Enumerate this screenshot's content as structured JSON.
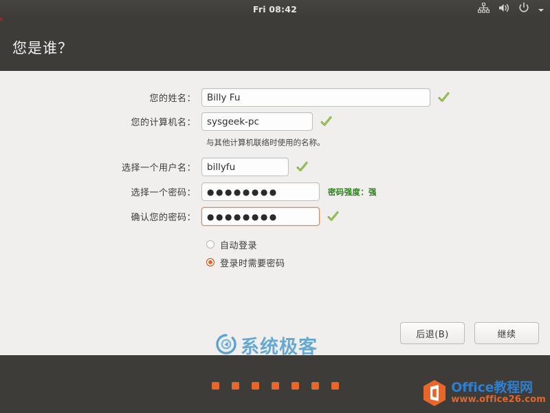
{
  "topbar": {
    "clock": "Fri 08:42",
    "icons": [
      "network-icon",
      "volume-icon",
      "power-icon",
      "chevron-down-icon"
    ]
  },
  "header": {
    "title": "您是谁？"
  },
  "form": {
    "fields": [
      {
        "label": "您的姓名：",
        "value": "Billy Fu",
        "name": "full-name-field",
        "valid": true
      },
      {
        "label": "您的计算机名：",
        "value": "sysgeek-pc",
        "name": "computer-name-field",
        "valid": true,
        "hint": "与其他计算机联络时使用的名称。"
      },
      {
        "label": "选择一个用户名：",
        "value": "billyfu",
        "name": "username-field",
        "valid": true
      },
      {
        "label": "选择一个密码：",
        "value": "●●●●●●●●",
        "name": "password-field",
        "strength": "密码强度：强"
      },
      {
        "label": "确认您的密码：",
        "value": "●●●●●●●●",
        "name": "confirm-password-field",
        "valid": true,
        "focused": true
      }
    ],
    "radios": [
      {
        "label": "自动登录",
        "selected": false
      },
      {
        "label": "登录时需要密码",
        "selected": true
      }
    ]
  },
  "buttons": {
    "back": "后退(B)",
    "continue": "继续"
  },
  "watermark": {
    "text": "系统极客"
  },
  "bottombar": {
    "step_dots": 7
  },
  "office_logo": {
    "line1": "Office教程网",
    "line2": "www.office26.com"
  },
  "colors": {
    "accent_orange": "#e8662a",
    "header_dark": "#3e3c39",
    "body_bg": "#f0efee",
    "valid_green": "#7fae3c",
    "strength_green": "#2e7d1f",
    "watermark_blue": "#5ba3d0",
    "focus_border": "#dd8b5e"
  }
}
